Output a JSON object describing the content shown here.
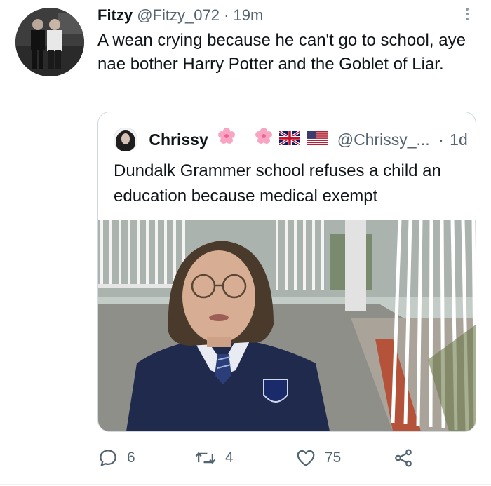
{
  "tweet": {
    "author_name": "Fitzy",
    "author_handle": "@Fitzy_072",
    "separator": "·",
    "time": "19m",
    "text": "A wean crying because he can't go to school, aye nae bother Harry Potter and the Goblet of Liar."
  },
  "quoted_tweet": {
    "author_name": "Chrissy",
    "author_handle": "@Chrissy_...",
    "separator": "·",
    "time": "1d",
    "emoji_icons": [
      "cherry-blossom-icon",
      "cherry-blossom-icon",
      "uk-flag-icon",
      "us-flag-icon"
    ],
    "text": "Dundalk Grammer school refuses a child an education because medical exempt"
  },
  "actions": {
    "reply_count": "6",
    "retweet_count": "4",
    "like_count": "75"
  },
  "colors": {
    "text": "#0f1419",
    "muted": "#536471",
    "border": "#cfd9de"
  }
}
